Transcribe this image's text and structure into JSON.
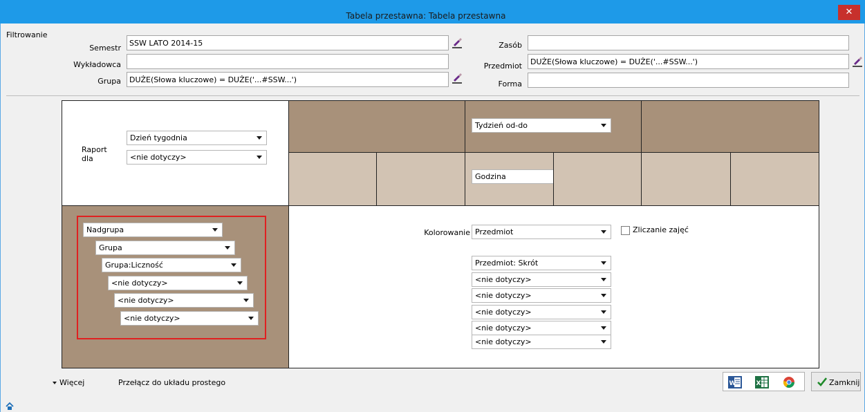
{
  "window": {
    "title": "Tabela przestawna: Tabela przestawna",
    "close_glyph": "✕"
  },
  "filter": {
    "legend": "Filtrowanie",
    "semestr": {
      "label": "Semestr",
      "value": "SSW LATO 2014-15"
    },
    "wykladowca": {
      "label": "Wykładowca",
      "value": ""
    },
    "grupa": {
      "label": "Grupa",
      "value": "DUŻE(Słowa kluczowe) = DUŻE('...#SSW...')"
    },
    "zasob": {
      "label": "Zasób",
      "value": ""
    },
    "przedmiot": {
      "label": "Przedmiot",
      "value": "DUŻE(Słowa kluczowe) = DUŻE('...#SSW...')"
    },
    "forma": {
      "label": "Forma",
      "value": ""
    }
  },
  "report": {
    "label": "Raport dla",
    "dropdown1": "Dzień tygodnia",
    "dropdown2": "<nie dotyczy>"
  },
  "columns": {
    "week": "Tydzień od-do",
    "hour": "Godzina"
  },
  "rows": {
    "items": [
      "Nadgrupa",
      "Grupa",
      "Grupa:Liczność",
      "<nie dotyczy>",
      "<nie dotyczy>",
      "<nie dotyczy>"
    ]
  },
  "content": {
    "coloring_label": "Kolorowanie",
    "coloring_value": "Przedmiot",
    "count_label": "Zliczanie zajęć",
    "count_checked": false,
    "fields": [
      "Przedmiot: Skrót",
      "<nie dotyczy>",
      "<nie dotyczy>",
      "<nie dotyczy>",
      "<nie dotyczy>",
      "<nie dotyczy>"
    ]
  },
  "footer": {
    "more_label": "Więcej",
    "simple_layout_link": "Przełącz do układu prostego",
    "close_label": "Zamknij",
    "export_icons": [
      "word-icon",
      "excel-icon",
      "chrome-icon"
    ]
  },
  "colors": {
    "titlebar": "#1e9ae8",
    "tan": "#a8917a",
    "light_tan": "#d2c3b3",
    "highlight": "#e02020"
  }
}
